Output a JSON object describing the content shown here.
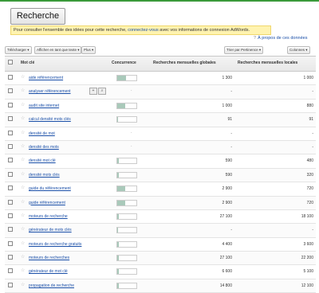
{
  "search_button": "Recherche",
  "notice": {
    "before": "Pour consulter l'ensemble des idées pour cette recherche,",
    "link": "connectez-vous",
    "after": "avec vos informations de connexion AdWords."
  },
  "about_link": "À propos de ces données",
  "toolbar": {
    "left1": "Télécharger ▾",
    "left2": "Afficher en tant que texte ▾",
    "left3": "Plus ▾",
    "right1": "Trier par Pertinence ▾",
    "right2": "Colonnes ▾"
  },
  "columns": {
    "keyword": "Mot clé",
    "competition": "Concurrence",
    "global": "Recherches mensuelles globales",
    "local": "Recherches mensuelles locales"
  },
  "rows": [
    {
      "kw": "aide référencement",
      "comp": 0.45,
      "global": "1 300",
      "local": "1 000"
    },
    {
      "kw": "analyser référencement",
      "comp": null,
      "global": "-",
      "local": "-"
    },
    {
      "kw": "audit site internet",
      "comp": 0.4,
      "global": "1 000",
      "local": "880"
    },
    {
      "kw": "calcul densité mots clés",
      "comp": 0.05,
      "global": "91",
      "local": "91"
    },
    {
      "kw": "densité de mot",
      "comp": null,
      "global": "-",
      "local": "-"
    },
    {
      "kw": "densité des mots",
      "comp": null,
      "global": "-",
      "local": "-"
    },
    {
      "kw": "densité mot clé",
      "comp": 0.1,
      "global": "590",
      "local": "480"
    },
    {
      "kw": "densité mots clés",
      "comp": 0.1,
      "global": "590",
      "local": "320"
    },
    {
      "kw": "guide du référencement",
      "comp": 0.4,
      "global": "2 900",
      "local": "720"
    },
    {
      "kw": "guide référencement",
      "comp": 0.4,
      "global": "2 900",
      "local": "720"
    },
    {
      "kw": "moteurs de recherche",
      "comp": 0.1,
      "global": "27 100",
      "local": "18 100"
    },
    {
      "kw": "générateur de mots clés",
      "comp": 0.05,
      "global": "-",
      "local": "-"
    },
    {
      "kw": "moteurs de recherche gratuits",
      "comp": 0.1,
      "global": "4 400",
      "local": "3 600"
    },
    {
      "kw": "moteurs de recherches",
      "comp": 0.1,
      "global": "27 100",
      "local": "22 200"
    },
    {
      "kw": "générateur de mot clé",
      "comp": 0.1,
      "global": "6 600",
      "local": "5 100"
    },
    {
      "kw": "propagation de recherche",
      "comp": 0.1,
      "global": "14 800",
      "local": "12 100"
    }
  ],
  "icons": {
    "star": "☆",
    "plus": "+",
    "magnifier": "🔍"
  }
}
